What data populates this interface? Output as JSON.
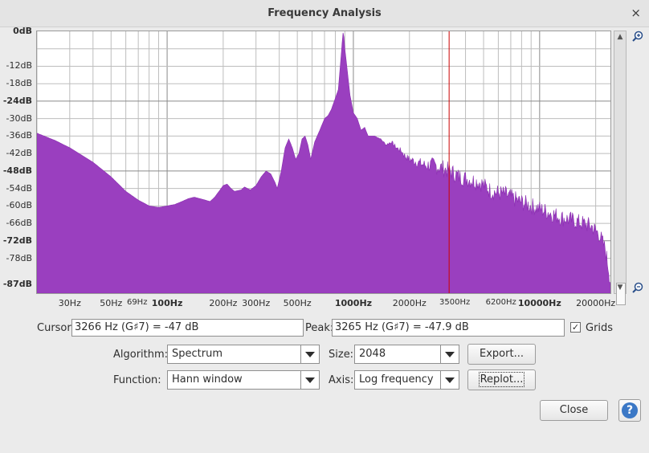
{
  "window": {
    "title": "Frequency Analysis",
    "close_glyph": "×"
  },
  "colors": {
    "spectrum_fill": "#9a3fbf",
    "cursor_line": "#cc0000",
    "grid": "#bdbdbd"
  },
  "chart_data": {
    "type": "area",
    "x_scale": "log",
    "xlim": [
      20,
      24000
    ],
    "ylim": [
      -90,
      0
    ],
    "grid": true,
    "y_ticks": [
      {
        "label": "0dB",
        "value": 0,
        "bold": true
      },
      {
        "label": "-12dB",
        "value": -12,
        "bold": false
      },
      {
        "label": "-18dB",
        "value": -18,
        "bold": false
      },
      {
        "label": "-24dB",
        "value": -24,
        "bold": true
      },
      {
        "label": "-30dB",
        "value": -30,
        "bold": false
      },
      {
        "label": "-36dB",
        "value": -36,
        "bold": false
      },
      {
        "label": "-42dB",
        "value": -42,
        "bold": false
      },
      {
        "label": "-48dB",
        "value": -48,
        "bold": true
      },
      {
        "label": "-54dB",
        "value": -54,
        "bold": false
      },
      {
        "label": "-60dB",
        "value": -60,
        "bold": false
      },
      {
        "label": "-66dB",
        "value": -66,
        "bold": false
      },
      {
        "label": "-72dB",
        "value": -72,
        "bold": true
      },
      {
        "label": "-78dB",
        "value": -78,
        "bold": false
      },
      {
        "label": "-87dB",
        "value": -87,
        "bold": true
      }
    ],
    "x_ticks": [
      {
        "label": "30Hz",
        "value": 30,
        "style": "normal"
      },
      {
        "label": "50Hz",
        "value": 50,
        "style": "normal"
      },
      {
        "label": "69Hz",
        "value": 69,
        "style": "small"
      },
      {
        "label": "100Hz",
        "value": 100,
        "style": "bold"
      },
      {
        "label": "200Hz",
        "value": 200,
        "style": "normal"
      },
      {
        "label": "300Hz",
        "value": 300,
        "style": "normal"
      },
      {
        "label": "500Hz",
        "value": 500,
        "style": "normal"
      },
      {
        "label": "1000Hz",
        "value": 1000,
        "style": "bold"
      },
      {
        "label": "2000Hz",
        "value": 2000,
        "style": "normal"
      },
      {
        "label": "3500Hz",
        "value": 3500,
        "style": "small"
      },
      {
        "label": "6200Hz",
        "value": 6200,
        "style": "small"
      },
      {
        "label": "10000Hz",
        "value": 10000,
        "style": "bold"
      },
      {
        "label": "20000Hz",
        "value": 20000,
        "style": "normal"
      }
    ],
    "cursor_hz": 3266,
    "points": [
      [
        20,
        -35
      ],
      [
        25,
        -37.5
      ],
      [
        30,
        -40
      ],
      [
        40,
        -45
      ],
      [
        50,
        -50
      ],
      [
        60,
        -55
      ],
      [
        70,
        -58
      ],
      [
        80,
        -60
      ],
      [
        90,
        -60.5
      ],
      [
        100,
        -60
      ],
      [
        110,
        -59.5
      ],
      [
        120,
        -58.5
      ],
      [
        130,
        -57.5
      ],
      [
        140,
        -57
      ],
      [
        150,
        -57.5
      ],
      [
        160,
        -58
      ],
      [
        170,
        -58.5
      ],
      [
        180,
        -57
      ],
      [
        190,
        -55
      ],
      [
        200,
        -53
      ],
      [
        210,
        -52.5
      ],
      [
        220,
        -54
      ],
      [
        230,
        -55
      ],
      [
        250,
        -54.5
      ],
      [
        260,
        -53.5
      ],
      [
        280,
        -54.5
      ],
      [
        300,
        -53
      ],
      [
        320,
        -50
      ],
      [
        340,
        -48
      ],
      [
        360,
        -49
      ],
      [
        380,
        -52
      ],
      [
        390,
        -54
      ],
      [
        410,
        -48
      ],
      [
        430,
        -40
      ],
      [
        450,
        -37
      ],
      [
        470,
        -40
      ],
      [
        490,
        -44
      ],
      [
        510,
        -42
      ],
      [
        530,
        -37
      ],
      [
        550,
        -36
      ],
      [
        570,
        -39
      ],
      [
        590,
        -44
      ],
      [
        620,
        -38
      ],
      [
        660,
        -34
      ],
      [
        700,
        -30
      ],
      [
        730,
        -29
      ],
      [
        760,
        -27
      ],
      [
        800,
        -23
      ],
      [
        830,
        -20
      ],
      [
        850,
        -12
      ],
      [
        870,
        -4
      ],
      [
        880,
        -0.5
      ],
      [
        890,
        -2
      ],
      [
        900,
        -6
      ],
      [
        930,
        -14
      ],
      [
        960,
        -22
      ],
      [
        1000,
        -28
      ],
      [
        1050,
        -30
      ],
      [
        1100,
        -34
      ],
      [
        1150,
        -33
      ],
      [
        1200,
        -36
      ],
      [
        1300,
        -36
      ],
      [
        1400,
        -37
      ],
      [
        1500,
        -39
      ],
      [
        1600,
        -38
      ],
      [
        1700,
        -40
      ],
      [
        1800,
        -41
      ],
      [
        1900,
        -43
      ],
      [
        2000,
        -44
      ],
      [
        2200,
        -45
      ],
      [
        2400,
        -46
      ],
      [
        2700,
        -46
      ],
      [
        3000,
        -47
      ],
      [
        3300,
        -48
      ],
      [
        3700,
        -50
      ],
      [
        4200,
        -51
      ],
      [
        4800,
        -52
      ],
      [
        5500,
        -55
      ],
      [
        6500,
        -56
      ],
      [
        7500,
        -58
      ],
      [
        9000,
        -60
      ],
      [
        11000,
        -62
      ],
      [
        13000,
        -64
      ],
      [
        15000,
        -65
      ],
      [
        17000,
        -66
      ],
      [
        19000,
        -67
      ],
      [
        21000,
        -70
      ],
      [
        22500,
        -75
      ],
      [
        23500,
        -82
      ],
      [
        24000,
        -87
      ]
    ]
  },
  "readouts": {
    "cursor_label": "Cursor:",
    "cursor_value": "3266 Hz (G♯7) = -47 dB",
    "peak_label": "Peak:",
    "peak_value": "3265 Hz (G♯7) = -47.9 dB",
    "grids_label": "Grids",
    "grids_checked": true
  },
  "controls": {
    "algorithm_label": "Algorithm:",
    "algorithm_value": "Spectrum",
    "size_label": "Size:",
    "size_value": "2048",
    "export_label": "Export...",
    "function_label": "Function:",
    "function_value": "Hann window",
    "axis_label": "Axis:",
    "axis_value": "Log frequency",
    "replot_label": "Replot...",
    "close_label": "Close",
    "help_glyph": "?"
  }
}
